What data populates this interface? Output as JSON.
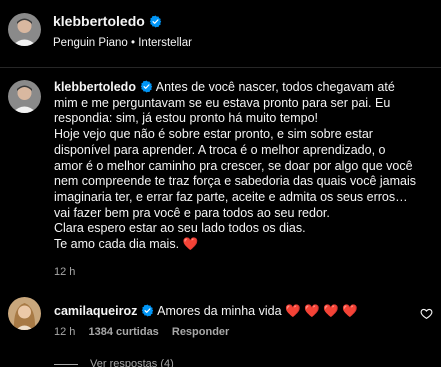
{
  "header": {
    "username": "klebbertoledo",
    "subtitle": "Penguin Piano • Interstellar"
  },
  "caption": {
    "username": "klebbertoledo",
    "lines": [
      "Antes de você nascer, todos chegavam até",
      "mim e me perguntavam se eu estava pronto para ser pai. Eu",
      "respondia: sim, já estou pronto há muito tempo!",
      "Hoje vejo que não é sobre estar pronto, e sim sobre estar",
      "disponível para aprender. A troca é o melhor aprendizado, o",
      "amor é o melhor caminho pra crescer, se doar por algo que você",
      "nem compreende te traz força e sabedoria das quais você jamais",
      "imaginaria ter, e errar faz parte, aceite e admita os seus erros…",
      "vai fazer bem pra você e para todos ao seu redor.",
      "Clara espero estar ao seu lado todos os dias.",
      "Te amo cada dia mais."
    ],
    "heart": "❤️",
    "time": "12 h"
  },
  "comment": {
    "username": "camilaqueiroz",
    "text": "Amores da minha vida",
    "hearts": "❤️ ❤️ ❤️ ❤️",
    "time": "12 h",
    "likes": "1384 curtidas",
    "reply": "Responder"
  },
  "view_replies": "Ver respostas (4)",
  "colors": {
    "background": "#000000",
    "text": "#f5f5f5",
    "secondary": "#a8a8a8",
    "verified": "#0095f6",
    "heart": "#ff3040"
  }
}
